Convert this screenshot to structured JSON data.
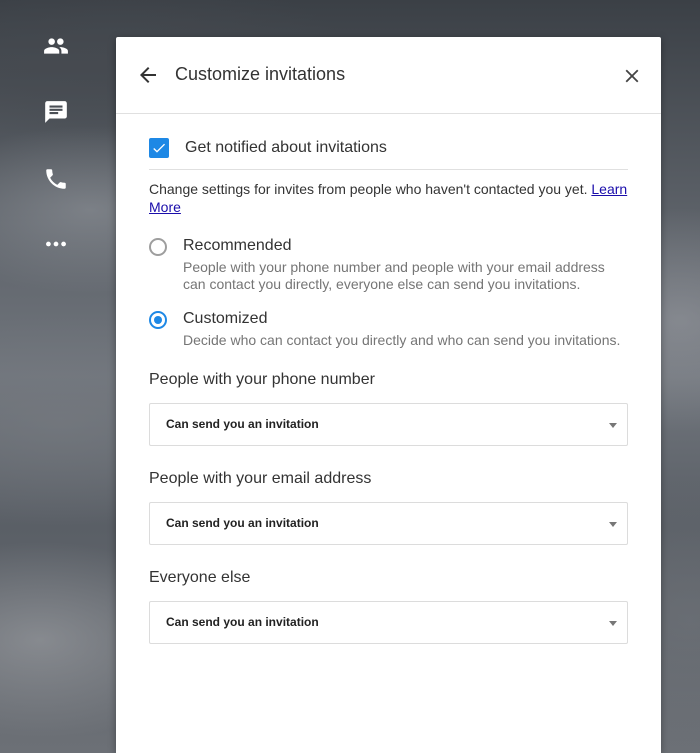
{
  "rail": {
    "items": [
      {
        "icon": "people-icon"
      },
      {
        "icon": "chat-icon"
      },
      {
        "icon": "phone-icon"
      },
      {
        "icon": "more-icon"
      }
    ]
  },
  "panel": {
    "title": "Customize invitations",
    "notify": {
      "label": "Get notified about invitations",
      "checked": true
    },
    "intro_text": "Change settings for invites from people who haven't contacted you yet. ",
    "learn_more": "Learn More",
    "options": [
      {
        "title": "Recommended",
        "description": "People with your phone number and people with your email address can contact you directly, everyone else can send you invitations.",
        "selected": false
      },
      {
        "title": "Customized",
        "description": "Decide who can contact you directly and who can send you invitations.",
        "selected": true
      }
    ],
    "fields": [
      {
        "label": "People with your phone number",
        "value": "Can send you an invitation"
      },
      {
        "label": "People with your email address",
        "value": "Can send you an invitation"
      },
      {
        "label": "Everyone else",
        "value": "Can send you an invitation"
      }
    ]
  },
  "colors": {
    "accent": "#1e88e5",
    "link": "#1a0dab"
  }
}
